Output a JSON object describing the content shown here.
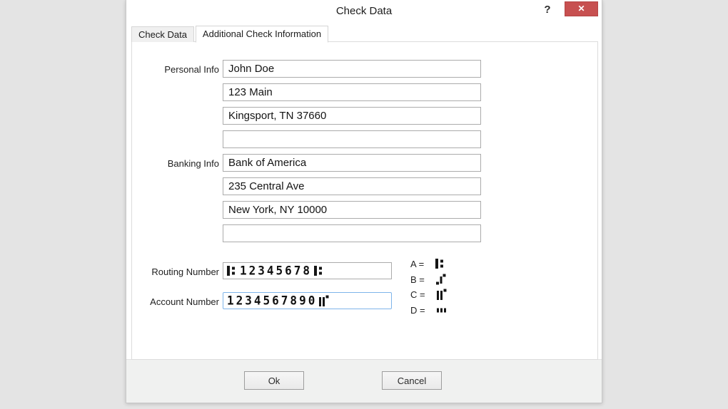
{
  "window": {
    "title": "Check Data",
    "help_icon": "?",
    "close_icon": "✕"
  },
  "tabs": [
    {
      "label": "Check Data",
      "active": false
    },
    {
      "label": "Additional Check Information",
      "active": true
    }
  ],
  "form": {
    "personal_label": "Personal Info",
    "personal_fields": [
      "John Doe",
      "123 Main",
      "Kingsport, TN 37660",
      ""
    ],
    "banking_label": "Banking Info",
    "banking_fields": [
      "Bank of America",
      "235 Central Ave",
      "New York, NY 10000",
      ""
    ],
    "routing_label": "Routing Number",
    "routing": {
      "start_symbol": "transit",
      "digits": "12345678",
      "end_symbol": "transit"
    },
    "account_label": "Account Number",
    "account": {
      "digits": "1234567890",
      "end_symbol": "on-us"
    }
  },
  "micr_legend": {
    "items": [
      {
        "label": "A =",
        "symbol": "transit"
      },
      {
        "label": "B =",
        "symbol": "amount"
      },
      {
        "label": "C =",
        "symbol": "on-us"
      },
      {
        "label": "D =",
        "symbol": "dash"
      }
    ]
  },
  "buttons": {
    "ok": "Ok",
    "cancel": "Cancel"
  },
  "colors": {
    "page_background": "#e4e4e4",
    "dialog_background": "#ffffff",
    "close_button_red": "#c75050",
    "field_border": "#ababab",
    "focused_field_border": "#7eb4ea"
  }
}
